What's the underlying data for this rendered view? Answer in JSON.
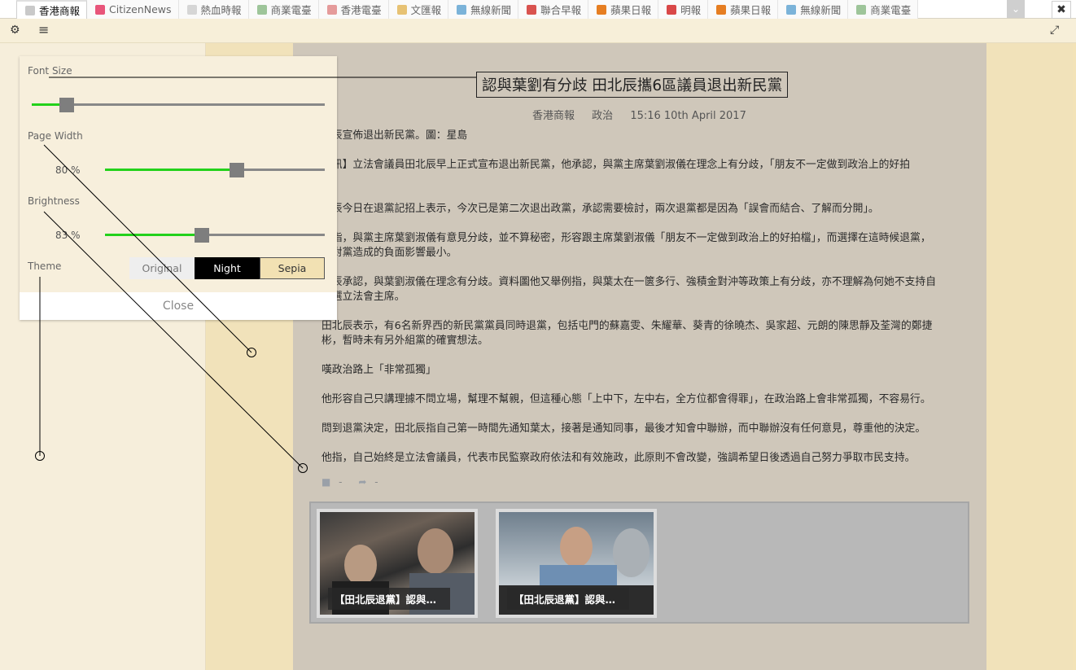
{
  "tabs": [
    {
      "label": "香港商報",
      "icon": "globe-icon",
      "color": "#c9c9c9",
      "active": true
    },
    {
      "label": "CitizenNews",
      "icon": "citizen-news-icon",
      "color": "#e8557a",
      "active": false
    },
    {
      "label": "熱血時報",
      "icon": "page-icon",
      "color": "#d6d6d6",
      "active": false
    },
    {
      "label": "商業電臺",
      "icon": "page-icon",
      "color": "#9ec59a",
      "active": false
    },
    {
      "label": "香港電臺",
      "icon": "page-icon",
      "color": "#e59b9b",
      "active": false
    },
    {
      "label": "文匯報",
      "icon": "page-icon",
      "color": "#e7c274",
      "active": false
    },
    {
      "label": "無線新聞",
      "icon": "globe-icon",
      "color": "#7bb3d9",
      "active": false
    },
    {
      "label": "聯合早報",
      "icon": "page-icon",
      "color": "#d9534f",
      "active": false
    },
    {
      "label": "蘋果日報",
      "icon": "page-icon",
      "color": "#e67e22",
      "active": false
    },
    {
      "label": "明報",
      "icon": "page-icon",
      "color": "#d94848",
      "active": false
    },
    {
      "label": "蘋果日報",
      "icon": "page-icon",
      "color": "#e67e22",
      "active": false
    },
    {
      "label": "無線新聞",
      "icon": "globe-icon",
      "color": "#7bb3d9",
      "active": false
    },
    {
      "label": "商業電臺",
      "icon": "page-icon",
      "color": "#9ec59a",
      "active": false
    }
  ],
  "toolbar": {
    "settings_icon": "⚙",
    "menu_icon": "≡",
    "fullscreen_icon": "⤢",
    "close_icon": "✖",
    "dropdown_icon": "⌄"
  },
  "settings": {
    "font_size_label": "Font Size",
    "font_size_value": 0.12,
    "page_width_label": "Page Width",
    "page_width_text": "80 %",
    "page_width_value": 0.6,
    "brightness_label": "Brightness",
    "brightness_text": "83 %",
    "brightness_value": 0.44,
    "theme_label": "Theme",
    "theme_options": [
      "Original",
      "Night",
      "Sepia"
    ],
    "close_label": "Close"
  },
  "article": {
    "title": "認與葉劉有分歧 田北辰攜6區議員退出新民黨",
    "source": "香港商報",
    "category": "政治",
    "timestamp": "15:16 10th April 2017",
    "paragraphs": [
      "北辰宣佈退出新民黨。圖：星島",
      "電訊】立法會議員田北辰早上正式宣布退出新民黨，他承認，與黨主席葉劉淑儀在理念上有分歧，「朋友不一定做到政治上的好拍\n。",
      "北辰今日在退黨記招上表示，今次已是第二次退出政黨，承認需要檢討，兩次退黨都是因為「誤會而結合、了解而分開」。",
      "又指，與黨主席葉劉淑儀有意見分歧，並不算秘密，形容跟主席葉劉淑儀「朋友不一定做到政治上的好拍檔」，而選擇在這時候退黨，\n信對黨造成的負面影響最小。",
      "北辰承認，與葉劉淑儀在理念有分歧。資料圖他又舉例指，與葉太在一篋多行、強積金對沖等政策上有分歧，亦不理解為何她不支持自\n參選立法會主席。",
      "田北辰表示，有6名新界西的新民黨黨員同時退黨，包括屯門的蘇嘉雯、朱耀華、葵青的徐曉杰、吳家超、元朗的陳思靜及荃灣的鄭捷\n彬，暫時未有另外組黨的確實想法。",
      "嘆政治路上「非常孤獨」",
      "他形容自己只講理據不問立場，幫理不幫親，但這種心態「上中下，左中右，全方位都會得罪」，在政治路上會非常孤獨，不容易行。",
      "問到退黨決定，田北辰指自己第一時間先通知葉太，接著是通知同事，最後才知會中聯辦，而中聯辦沒有任何意見，尊重他的決定。",
      "他指，自己始終是立法會議員，代表市民監察政府依法和有效施政，此原則不會改變，強調希望日後透過自己努力爭取市民支持。"
    ],
    "comment_count": "-",
    "share_count": "-",
    "gallery": [
      {
        "caption": "【田北辰退黨】認與葉..."
      },
      {
        "caption": "【田北辰退黨】認與葉..."
      }
    ]
  },
  "colors": {
    "slider_fill": "#23d11b",
    "sepia_bg": "#f3e3b8",
    "article_bg": "#cfc7ba"
  }
}
